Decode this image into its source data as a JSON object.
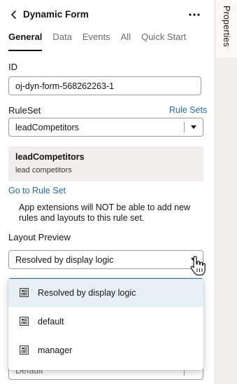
{
  "header": {
    "title": "Dynamic Form"
  },
  "tabs": [
    {
      "label": "General",
      "active": true
    },
    {
      "label": "Data"
    },
    {
      "label": "Events"
    },
    {
      "label": "All"
    },
    {
      "label": "Quick Start"
    }
  ],
  "side_tab": {
    "label": "Properties"
  },
  "id_field": {
    "label": "ID",
    "value": "oj-dyn-form-568262263-1"
  },
  "ruleset": {
    "label": "RuleSet",
    "link": "Rule Sets",
    "value": "leadCompetitors"
  },
  "info_card": {
    "title": "leadCompetitors",
    "subtitle": "lead competitors"
  },
  "go_to_rule_set": "Go to Rule Set",
  "notice": "App extensions will NOT be able to add new rules and layouts to this rule set.",
  "layout_preview": {
    "label": "Layout Preview",
    "value": "Resolved by display logic",
    "options": [
      "Resolved by display logic",
      "default",
      "manager"
    ]
  },
  "hidden_select": {
    "value": "Default"
  },
  "colors": {
    "link": "#1f6dac",
    "selected_option_bg": "#e7f1f5",
    "card_bg": "#f1efed"
  }
}
